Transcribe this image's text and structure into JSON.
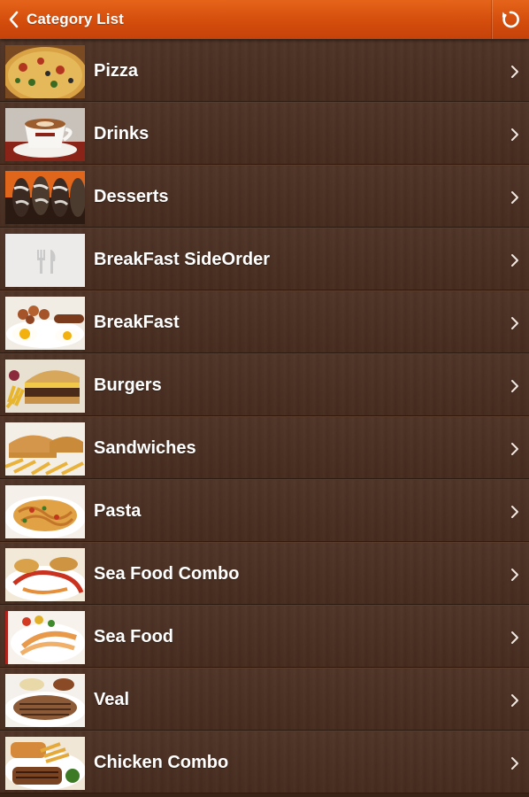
{
  "header": {
    "title": "Category List",
    "back_icon": "chevron-left-icon",
    "refresh_icon": "refresh-icon",
    "accent_color": "#d94f0f"
  },
  "categories": [
    {
      "label": "Pizza",
      "thumb": "pizza"
    },
    {
      "label": "Drinks",
      "thumb": "coffee"
    },
    {
      "label": "Desserts",
      "thumb": "desserts"
    },
    {
      "label": "BreakFast SideOrder",
      "thumb": "placeholder-fork-knife"
    },
    {
      "label": "BreakFast",
      "thumb": "breakfast"
    },
    {
      "label": "Burgers",
      "thumb": "burger"
    },
    {
      "label": "Sandwiches",
      "thumb": "sandwich"
    },
    {
      "label": "Pasta",
      "thumb": "pasta"
    },
    {
      "label": "Sea Food Combo",
      "thumb": "seafood-combo"
    },
    {
      "label": "Sea Food",
      "thumb": "seafood"
    },
    {
      "label": "Veal",
      "thumb": "veal"
    },
    {
      "label": "Chicken Combo",
      "thumb": "chicken-combo"
    }
  ]
}
